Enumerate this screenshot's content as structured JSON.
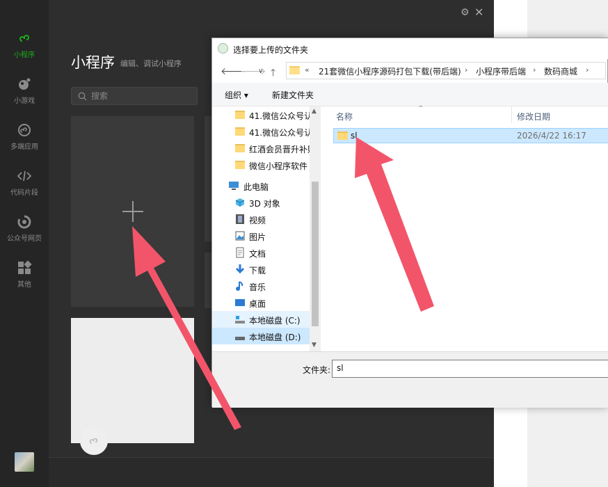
{
  "sidebar": {
    "items": [
      {
        "label": "小程序",
        "icon": "miniprogram-icon",
        "active": true
      },
      {
        "label": "小游戏",
        "icon": "minigame-icon",
        "active": false
      },
      {
        "label": "多端应用",
        "icon": "multiapp-icon",
        "active": false
      },
      {
        "label": "代码片段",
        "icon": "code-icon",
        "active": false
      },
      {
        "label": "公众号网页",
        "icon": "webpage-icon",
        "active": false
      },
      {
        "label": "其他",
        "icon": "grid-icon",
        "active": false
      }
    ]
  },
  "main": {
    "title": "小程序",
    "subtitle": "编辑、调试小程序",
    "search_placeholder": "搜索"
  },
  "dialog": {
    "title": "选择要上传的文件夹",
    "breadcrumbs": [
      "21套微信小程序源码打包下载(带后端)",
      "小程序带后端",
      "数码商城"
    ],
    "breadcrumb_prefix": "«",
    "toolbar": {
      "organize": "组织 ▾",
      "new_folder": "新建文件夹"
    },
    "tree": [
      {
        "label": "41.微信公众号认",
        "icon": "folder-icon"
      },
      {
        "label": "41.微信公众号认",
        "icon": "folder-icon"
      },
      {
        "label": "红酒会员晋升补贴",
        "icon": "folder-icon"
      },
      {
        "label": "微信小程序软件",
        "icon": "folder-icon"
      },
      {
        "label": "此电脑",
        "icon": "computer-icon"
      },
      {
        "label": "3D 对象",
        "icon": "3d-icon"
      },
      {
        "label": "视频",
        "icon": "video-icon"
      },
      {
        "label": "图片",
        "icon": "picture-icon"
      },
      {
        "label": "文档",
        "icon": "document-icon"
      },
      {
        "label": "下载",
        "icon": "download-icon"
      },
      {
        "label": "音乐",
        "icon": "music-icon"
      },
      {
        "label": "桌面",
        "icon": "desktop-icon"
      },
      {
        "label": "本地磁盘 (C:)",
        "icon": "drive-icon"
      },
      {
        "label": "本地磁盘 (D:)",
        "icon": "drive-icon"
      }
    ],
    "columns": {
      "name": "名称",
      "modified": "修改日期"
    },
    "files": [
      {
        "name": "sl",
        "modified": "2026/4/22 16:17"
      }
    ],
    "folder_label": "文件夹:",
    "folder_value": "sl"
  },
  "colors": {
    "accent": "#1aad19",
    "arrow": "#f2556a",
    "selection": "#cce8ff"
  }
}
